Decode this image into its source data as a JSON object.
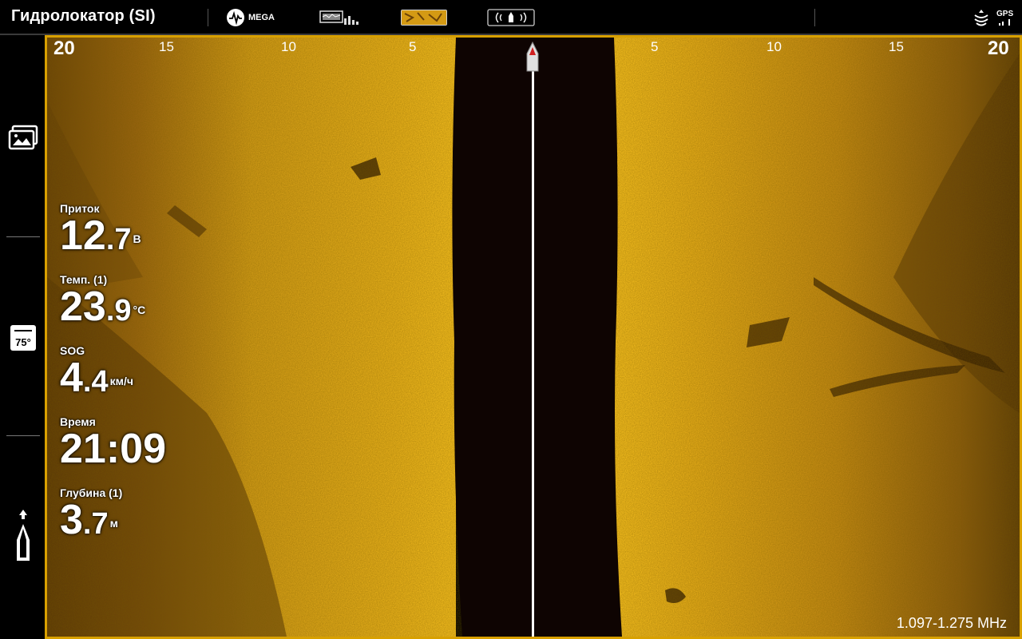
{
  "header": {
    "title": "Гидролокатор (SI)",
    "mega_label": "MEGA",
    "gps_label": "GPS"
  },
  "sidebar": {
    "temp_badge": "75°"
  },
  "sonar": {
    "scale_left": [
      "20",
      "15",
      "10",
      "5"
    ],
    "scale_right": [
      "5",
      "10",
      "15",
      "20"
    ],
    "frequency": "1.097-1.275 MHz"
  },
  "readouts": [
    {
      "label": "Приток",
      "int": "12",
      "frac": ".7",
      "unit": "В"
    },
    {
      "label": "Темп. (1)",
      "int": "23",
      "frac": ".9",
      "unit": "°C"
    },
    {
      "label": "SOG",
      "int": "4",
      "frac": ".4",
      "unit": "км/ч"
    },
    {
      "label": "Время",
      "int": "21:09",
      "frac": "",
      "unit": ""
    },
    {
      "label": "Глубина (1)",
      "int": "3",
      "frac": ".7",
      "unit": "м"
    }
  ],
  "colors": {
    "sonar_bright": "#f0b21a",
    "sonar_dark": "#5a3a08",
    "water_column": "#0e0402",
    "frame": "#d8a000"
  }
}
